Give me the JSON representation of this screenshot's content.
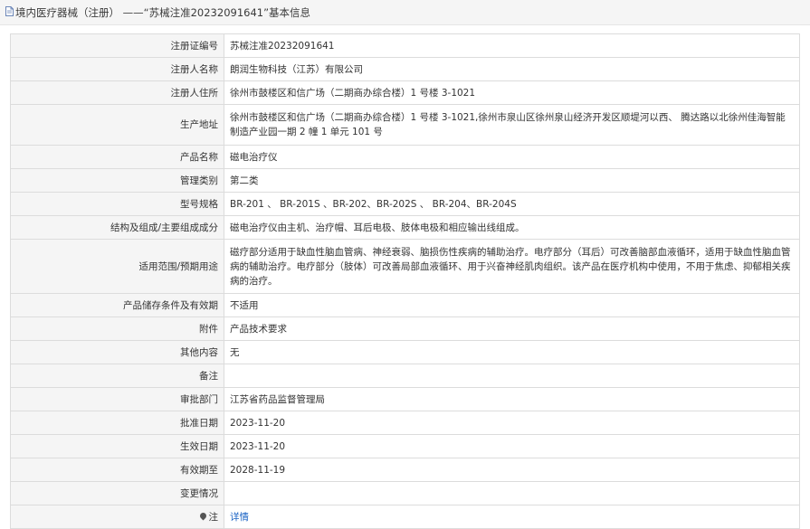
{
  "header": {
    "title": "境内医疗器械（注册） ——“苏械注准20232091641”基本信息"
  },
  "rows": [
    {
      "label": "注册证编号",
      "value": "苏械注准20232091641"
    },
    {
      "label": "注册人名称",
      "value": "朗润生物科技（江苏）有限公司"
    },
    {
      "label": "注册人住所",
      "value": "徐州市鼓楼区和信广场（二期商办综合楼）1 号楼 3-1021"
    },
    {
      "label": "生产地址",
      "value": "徐州市鼓楼区和信广场（二期商办综合楼）1 号楼 3-1021,徐州市泉山区徐州泉山经济开发区顺堤河以西、 腾达路以北徐州佳海智能制造产业园一期 2 幢 1 单元 101 号"
    },
    {
      "label": "产品名称",
      "value": "磁电治疗仪"
    },
    {
      "label": "管理类别",
      "value": "第二类"
    },
    {
      "label": "型号规格",
      "value": "BR-201 、 BR-201S 、BR-202、BR-202S 、 BR-204、BR-204S"
    },
    {
      "label": "结构及组成/主要组成成分",
      "value": "磁电治疗仪由主机、治疗帽、耳后电极、肢体电极和相应输出线组成。"
    },
    {
      "label": "适用范围/预期用途",
      "value": "磁疗部分适用于缺血性脑血管病、神经衰弱、脑损伤性疾病的辅助治疗。电疗部分（耳后）可改善脑部血液循环，适用于缺血性脑血管病的辅助治疗。电疗部分（肢体）可改善局部血液循环、用于兴奋神经肌肉组织。该产品在医疗机构中使用，不用于焦虑、抑郁相关疾病的治疗。"
    },
    {
      "label": "产品储存条件及有效期",
      "value": "不适用"
    },
    {
      "label": "附件",
      "value": "产品技术要求"
    },
    {
      "label": "其他内容",
      "value": "无"
    },
    {
      "label": "备注",
      "value": ""
    },
    {
      "label": "审批部门",
      "value": "江苏省药品监督管理局"
    },
    {
      "label": "批准日期",
      "value": "2023-11-20"
    },
    {
      "label": "生效日期",
      "value": "2023-11-20"
    },
    {
      "label": "有效期至",
      "value": "2028-11-19"
    },
    {
      "label": "变更情况",
      "value": ""
    }
  ],
  "note_row": {
    "label": "注",
    "link_text": "详情",
    "link_color": "#1a63c4"
  }
}
